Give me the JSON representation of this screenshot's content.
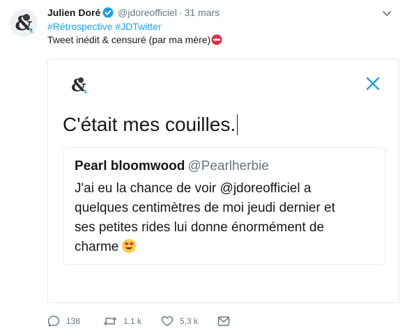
{
  "tweet": {
    "author_name": "Julien Doré",
    "author_handle": "@jdoreofficiel",
    "separator": "·",
    "date": "31 mars",
    "hashtags": [
      "#Rétrospective",
      "#JDTwitter"
    ],
    "text": "Tweet inédit & censuré (par ma mère)"
  },
  "media": {
    "text": "C'était mes couilles.",
    "quoted": {
      "author_name": "Pearl bloomwood",
      "author_handle": "@Pearlherbie",
      "lines": [
        "J'ai eu la chance de voir @jdoreofficiel a",
        "quelques centimètres de moi jeudi dernier et",
        "ses petites rides lui donne énormément de",
        "charme"
      ]
    }
  },
  "actions": {
    "reply_count": "138",
    "retweet_count": "1,1 k",
    "like_count": "5,3 k"
  },
  "colors": {
    "accent": "#1da1f2",
    "muted": "#657786",
    "border": "#e1e8ed",
    "no_entry_red": "#dd2e44"
  },
  "icons": [
    "verified-badge-icon",
    "caret-down-icon",
    "no-entry-icon",
    "close-icon",
    "heart-eyes-emoji-icon",
    "reply-icon",
    "retweet-icon",
    "like-icon",
    "direct-message-icon"
  ]
}
